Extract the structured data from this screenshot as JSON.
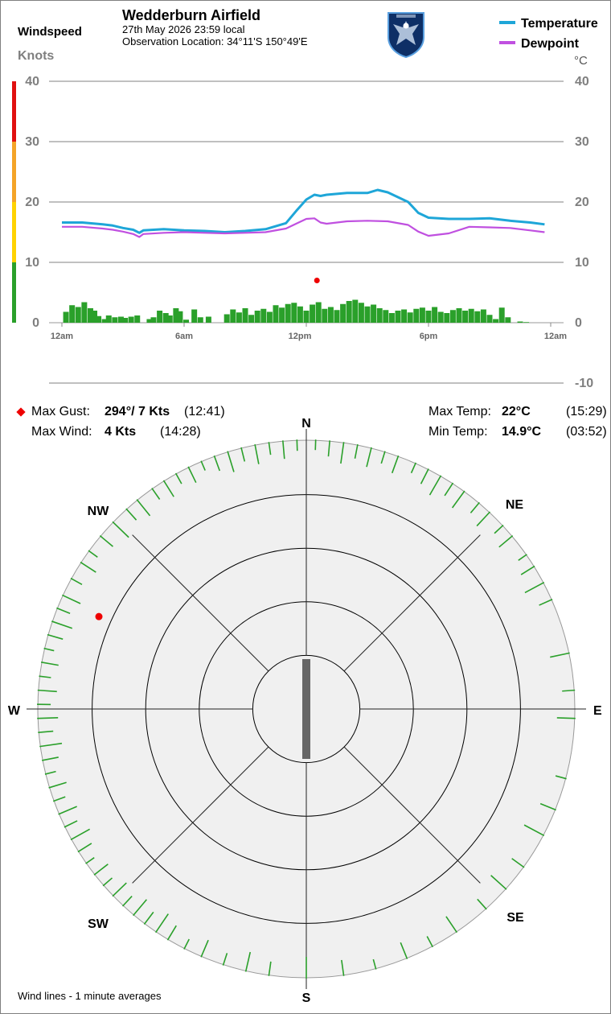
{
  "header": {
    "windspeed_label": "Windspeed",
    "knots_label": "Knots",
    "site_title": "Wedderburn Airfield",
    "date_line": "27th May 2026  23:59 local",
    "location_line": "Observation Location: 34°11'S 150°49'E",
    "celsius_unit": "°C",
    "logo_icon": "airfield-eagle-shield-logo"
  },
  "legend": [
    {
      "label": "Temperature",
      "color": "#1ea6d8"
    },
    {
      "label": "Dewpoint",
      "color": "#c050e0"
    }
  ],
  "colors": {
    "wind_bars": "#2aa02a",
    "gust_marker": "#ee0000",
    "scale_green": "#2aa02a",
    "scale_yellow": "#ffd200",
    "scale_orange": "#f4a428",
    "scale_red": "#e01010",
    "rose_background": "#f0f0f0",
    "avg_wind_bar": "#666666"
  },
  "chart_data": {
    "type": "line",
    "x_ticks": [
      "12am",
      "6am",
      "12pm",
      "6pm",
      "12am"
    ],
    "x_range_hours": [
      0,
      24
    ],
    "left_axis": {
      "label": "Knots",
      "ticks": [
        0,
        10,
        20,
        30,
        40
      ],
      "range": [
        0,
        40
      ]
    },
    "right_axis": {
      "label": "°C",
      "ticks": [
        -10,
        0,
        10,
        20,
        30,
        40
      ],
      "range": [
        -10,
        40
      ]
    },
    "grid": true,
    "legend_position": "top-right",
    "series": [
      {
        "name": "Temperature",
        "axis": "right",
        "x": [
          0,
          1,
          2,
          2.5,
          3,
          3.5,
          3.8,
          4,
          5,
          6,
          7,
          8,
          9,
          10,
          11,
          11.5,
          12,
          12.4,
          12.7,
          13,
          14,
          15,
          15.5,
          16,
          17,
          17.5,
          18,
          19,
          20,
          21,
          22,
          23,
          23.7
        ],
        "y": [
          16.6,
          16.6,
          16.3,
          16.1,
          15.7,
          15.4,
          14.9,
          15.3,
          15.5,
          15.3,
          15.2,
          15.0,
          15.2,
          15.5,
          16.5,
          18.5,
          20.4,
          21.2,
          21.0,
          21.2,
          21.5,
          21.5,
          22.0,
          21.6,
          20.0,
          18.2,
          17.4,
          17.2,
          17.2,
          17.3,
          16.9,
          16.6,
          16.3
        ]
      },
      {
        "name": "Dewpoint",
        "axis": "right",
        "x": [
          0,
          1,
          2,
          2.5,
          3,
          3.5,
          3.8,
          4,
          5,
          6,
          7,
          8,
          9,
          10,
          11,
          11.5,
          12,
          12.4,
          12.7,
          13,
          14,
          15,
          16,
          17,
          17.5,
          18,
          19,
          20,
          21,
          22,
          23,
          23.7
        ],
        "y": [
          15.9,
          15.9,
          15.6,
          15.4,
          15.1,
          14.7,
          14.2,
          14.7,
          14.9,
          15.0,
          14.9,
          14.8,
          14.9,
          15.0,
          15.6,
          16.4,
          17.2,
          17.3,
          16.6,
          16.4,
          16.8,
          16.9,
          16.8,
          16.2,
          15.1,
          14.4,
          14.8,
          15.9,
          15.8,
          15.7,
          15.3,
          15.0
        ]
      },
      {
        "name": "Windspeed",
        "type": "bar",
        "axis": "left",
        "x": [
          0.2,
          0.5,
          0.8,
          1.1,
          1.4,
          1.6,
          1.8,
          2.1,
          2.3,
          2.6,
          2.9,
          3.1,
          3.4,
          3.7,
          4.0,
          4.3,
          4.5,
          4.8,
          5.1,
          5.3,
          5.6,
          5.8,
          6.1,
          6.5,
          6.8,
          7.2,
          7.6,
          8.1,
          8.4,
          8.7,
          9.0,
          9.3,
          9.6,
          9.9,
          10.2,
          10.5,
          10.8,
          11.1,
          11.4,
          11.7,
          12.0,
          12.3,
          12.6,
          12.9,
          13.2,
          13.5,
          13.8,
          14.1,
          14.4,
          14.7,
          15.0,
          15.3,
          15.6,
          15.9,
          16.2,
          16.5,
          16.8,
          17.1,
          17.4,
          17.7,
          18.0,
          18.3,
          18.6,
          18.9,
          19.2,
          19.5,
          19.8,
          20.1,
          20.4,
          20.7,
          21.0,
          21.3,
          21.6,
          21.9,
          22.2,
          22.5,
          22.8,
          23.3
        ],
        "y": [
          1.8,
          2.9,
          2.6,
          3.4,
          2.4,
          2.0,
          1.1,
          0.6,
          1.2,
          0.9,
          1.0,
          0.8,
          1.0,
          1.2,
          0.0,
          0.6,
          0.9,
          2.0,
          1.6,
          1.2,
          2.4,
          1.9,
          0.5,
          2.2,
          0.9,
          1.0,
          0.0,
          1.4,
          2.2,
          1.7,
          2.4,
          1.3,
          2.0,
          2.3,
          1.8,
          2.9,
          2.5,
          3.1,
          3.3,
          2.7,
          2.0,
          3.0,
          3.4,
          2.3,
          2.6,
          2.1,
          3.1,
          3.6,
          3.8,
          3.3,
          2.7,
          3.0,
          2.4,
          2.1,
          1.6,
          2.0,
          2.2,
          1.7,
          2.3,
          2.5,
          2.0,
          2.6,
          1.8,
          1.6,
          2.1,
          2.4,
          2.0,
          2.3,
          1.9,
          2.2,
          1.3,
          0.6,
          2.5,
          0.9,
          0.0,
          0.2,
          0.1,
          0.0
        ]
      },
      {
        "name": "Max Gust",
        "type": "scatter",
        "axis": "left",
        "x": [
          12.68
        ],
        "y": [
          7
        ]
      }
    ]
  },
  "stats": {
    "max_gust": {
      "label": "Max Gust:",
      "value": "294°/ 7 Kts",
      "time": "(12:41)"
    },
    "max_wind": {
      "label": "Max Wind:",
      "value": "4 Kts",
      "time": "(14:28)"
    },
    "max_temp": {
      "label": "Max Temp:",
      "value": "22°C",
      "time": "(15:29)"
    },
    "min_temp": {
      "label": "Min Temp:",
      "value": "14.9°C",
      "time": "(03:52)"
    }
  },
  "wind_rose": {
    "compass": {
      "n": "N",
      "ne": "NE",
      "e": "E",
      "se": "SE",
      "s": "S",
      "sw": "SW",
      "w": "W",
      "nw": "NW"
    },
    "rings": 5,
    "max_gust_direction_deg": 294,
    "max_gust_kts": 7,
    "average_bar_direction_deg": 0,
    "wind_line_directions_deg": [
      2,
      5,
      8,
      11,
      14,
      17,
      20,
      24,
      27,
      30,
      33,
      36,
      40,
      43,
      47,
      50,
      55,
      58,
      62,
      66,
      78,
      86,
      92,
      105,
      112,
      118,
      126,
      132,
      138,
      146,
      152,
      158,
      165,
      172,
      180,
      188,
      193,
      198,
      203,
      207,
      211,
      214,
      217,
      220,
      223,
      226,
      229,
      232,
      235,
      238,
      241,
      244,
      247,
      250,
      253,
      256,
      259,
      262,
      265,
      268,
      271,
      274,
      277,
      280,
      283,
      286,
      289,
      292,
      295,
      299,
      303,
      306,
      310,
      314,
      318,
      321,
      325,
      328,
      331,
      334,
      337,
      340,
      343,
      346,
      349,
      352,
      355,
      358
    ]
  },
  "footnote": "Wind lines - 1 minute averages"
}
